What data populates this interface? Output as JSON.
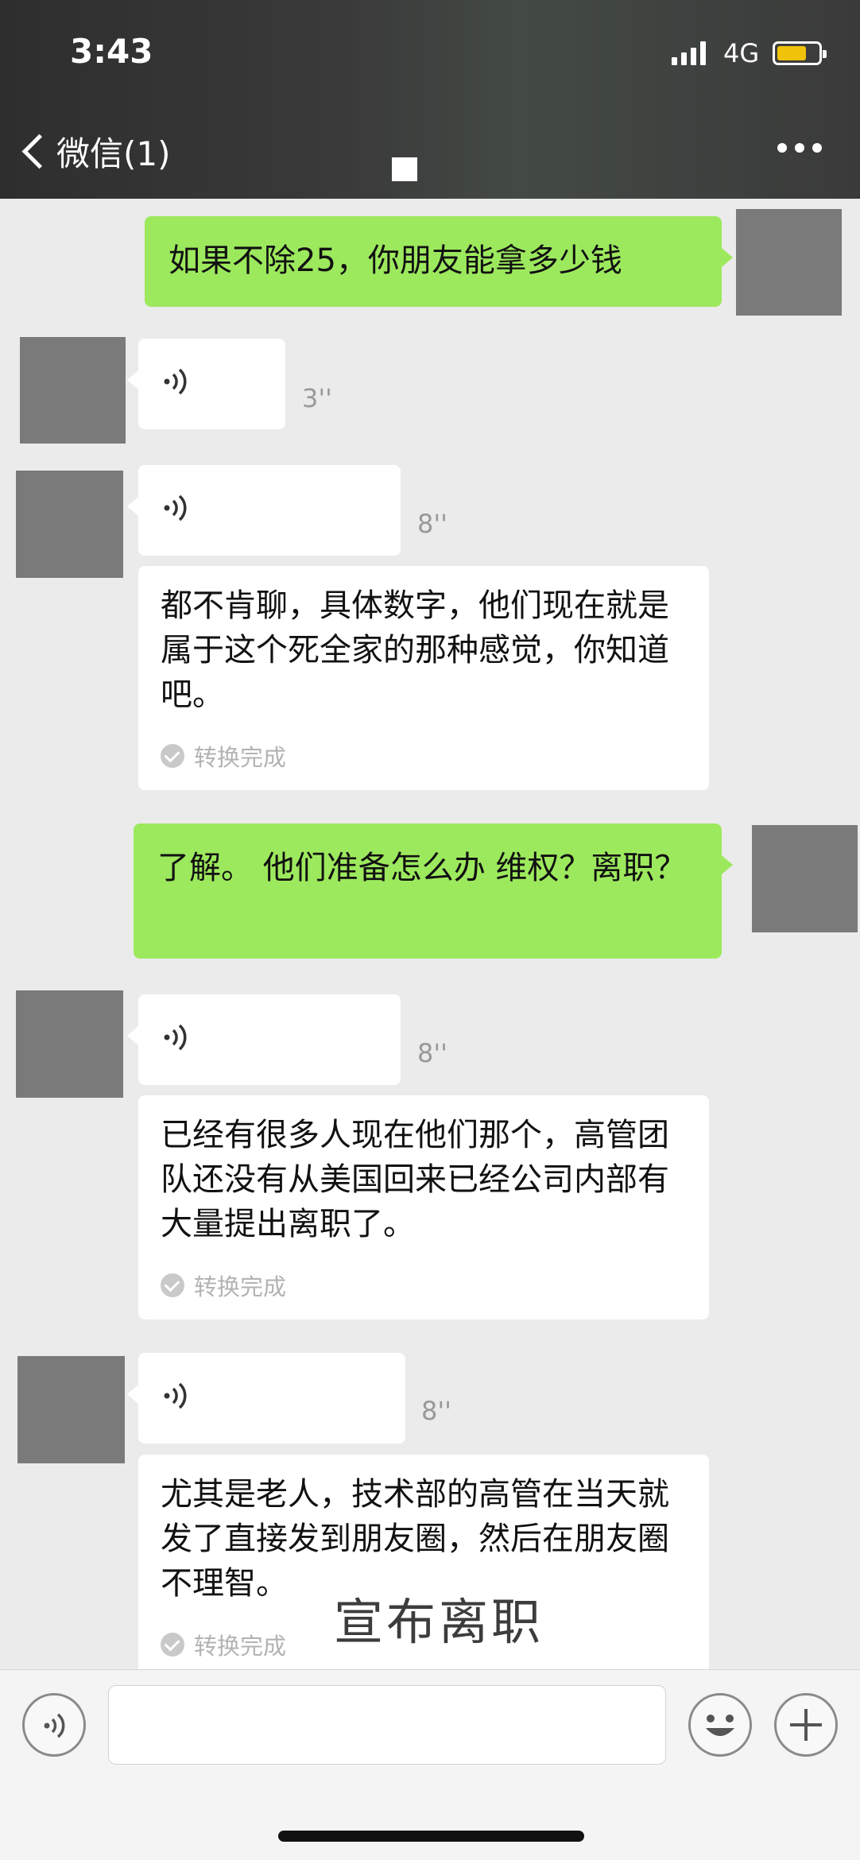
{
  "status_bar": {
    "time": "3:43",
    "network": "4G"
  },
  "nav": {
    "back_label": "微信(1)"
  },
  "messages": {
    "m1": {
      "text": "如果不除25，你朋友能拿多少钱"
    },
    "m2": {
      "duration": "3''"
    },
    "m3": {
      "duration": "8''",
      "transcript": "都不肯聊，具体数字，他们现在就是属于这个死全家的那种感觉，你知道吧。",
      "status": "转换完成"
    },
    "m4": {
      "text": "了解。 他们准备怎么办 维权？离职？"
    },
    "m5": {
      "duration": "8''",
      "transcript": "已经有很多人现在他们那个，高管团队还没有从美国回来已经公司内部有大量提出离职了。",
      "status": "转换完成"
    },
    "m6": {
      "duration": "8''",
      "transcript": "尤其是老人，技术部的高管在当天就发了直接发到朋友圈，然后在朋友圈不理智。",
      "status": "转换完成"
    }
  },
  "watermark": "宣布离职",
  "input": {
    "value": ""
  },
  "icons": {
    "voice": "voice-wave-icon",
    "emoji": "emoji-icon",
    "plus": "plus-icon",
    "check": "check-circle-icon"
  },
  "colors": {
    "sent_bubble": "#9de95e",
    "received_bubble": "#ffffff",
    "background": "#ebebeb"
  }
}
